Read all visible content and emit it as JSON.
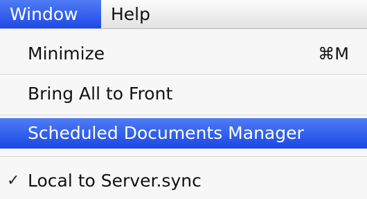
{
  "menubar": {
    "items": [
      {
        "label": "Window",
        "active": true
      },
      {
        "label": "Help",
        "active": false
      }
    ]
  },
  "dropdown": {
    "items": [
      {
        "label": "Minimize",
        "shortcut": "⌘M",
        "checked": false,
        "highlighted": false
      },
      {
        "label": "Bring All to Front",
        "shortcut": "",
        "checked": false,
        "highlighted": false
      },
      {
        "label": "Scheduled Documents Manager",
        "shortcut": "",
        "checked": false,
        "highlighted": true
      },
      {
        "label": "Local to Server.sync",
        "shortcut": "",
        "checked": true,
        "highlighted": false,
        "check_icon": "checkmark-icon"
      }
    ]
  },
  "colors": {
    "highlight": "#2f5af0",
    "menu_background": "#f7f7f7",
    "text": "#121212"
  }
}
